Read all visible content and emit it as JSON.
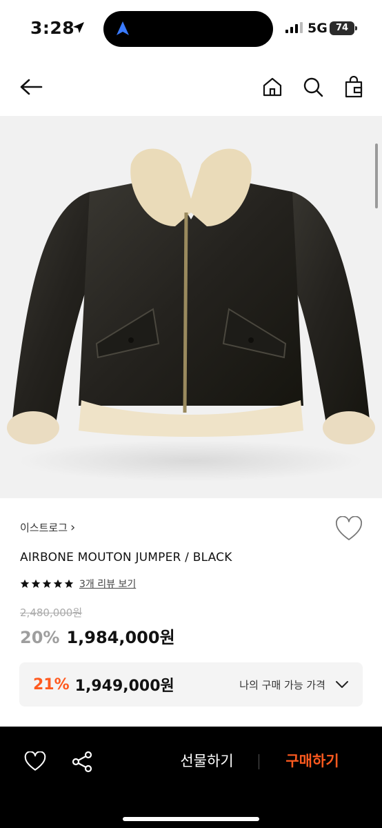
{
  "status_bar": {
    "time": "3:28",
    "network": "5G",
    "battery": "74"
  },
  "header": {
    "back_icon": "arrow-left-icon",
    "home_icon": "home-icon",
    "search_icon": "search-icon",
    "cart_icon": "shopping-bag-icon"
  },
  "product": {
    "brand": "이스트로그",
    "brand_chevron": "›",
    "name": "AIRBONE MOUTON JUMPER / BLACK",
    "rating": 5,
    "rating_max": 5,
    "review_link": "3개 리뷰 보기",
    "original_price": "2,480,000원",
    "discount": "20%",
    "sale_price": "1,984,000원",
    "image_icon": "product-photo"
  },
  "my_price": {
    "discount": "21%",
    "price": "1,949,000원",
    "label": "나의 구매 가능 가격"
  },
  "bottom_bar": {
    "wish_icon": "heart-icon",
    "share_icon": "share-icon",
    "gift_label": "선물하기",
    "buy_label": "구매하기"
  },
  "colors": {
    "accent": "#ff5a1f",
    "bar": "#000000",
    "discount_gray": "#9e9e9e"
  }
}
